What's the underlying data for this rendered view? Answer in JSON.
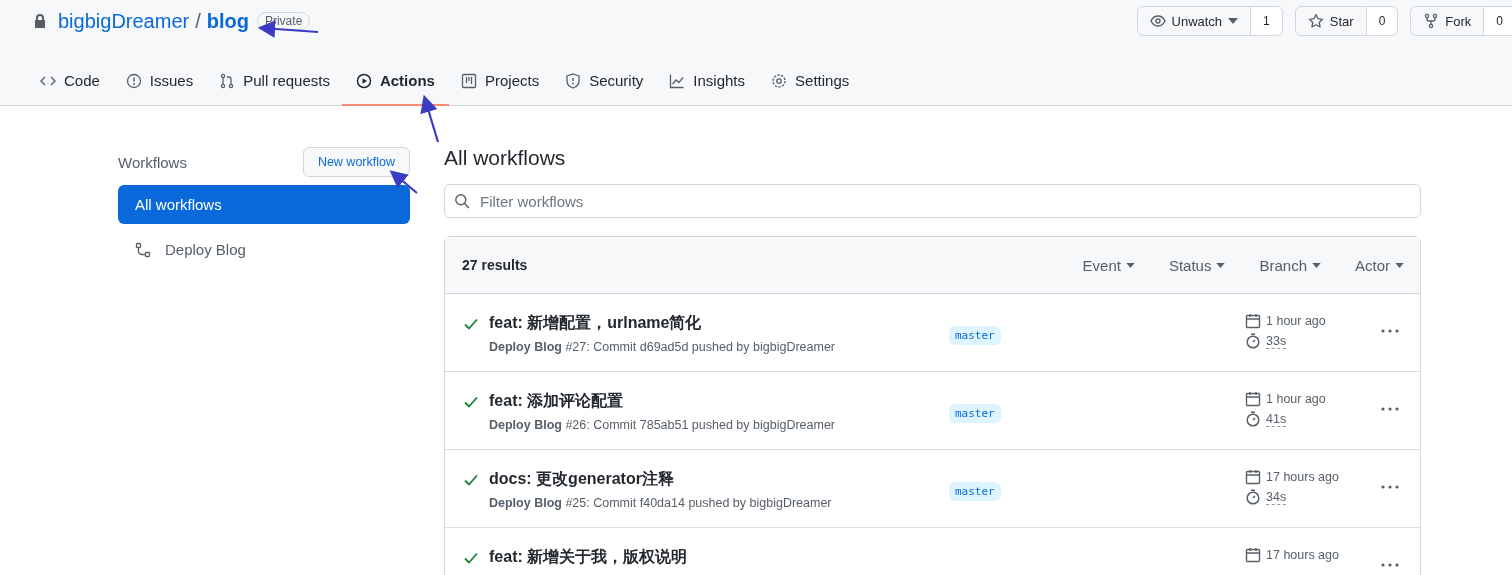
{
  "repo": {
    "owner": "bigbigDreamer",
    "name": "blog",
    "separator": "/",
    "visibility": "Private"
  },
  "repo_actions": [
    {
      "kind": "watch",
      "label": "Unwatch",
      "count": "1"
    },
    {
      "kind": "star",
      "label": "Star",
      "count": "0"
    },
    {
      "kind": "fork",
      "label": "Fork",
      "count": "0"
    }
  ],
  "tabs": [
    {
      "kind": "code",
      "label": "Code",
      "selected": false
    },
    {
      "kind": "issues",
      "label": "Issues",
      "selected": false
    },
    {
      "kind": "pulls",
      "label": "Pull requests",
      "selected": false
    },
    {
      "kind": "actions",
      "label": "Actions",
      "selected": true
    },
    {
      "kind": "projects",
      "label": "Projects",
      "selected": false
    },
    {
      "kind": "security",
      "label": "Security",
      "selected": false
    },
    {
      "kind": "insights",
      "label": "Insights",
      "selected": false
    },
    {
      "kind": "settings",
      "label": "Settings",
      "selected": false
    }
  ],
  "sidebar": {
    "title": "Workflows",
    "new_button": "New workflow",
    "items": [
      {
        "kind": "all",
        "label": "All workflows",
        "selected": true
      },
      {
        "kind": "workflow",
        "label": "Deploy Blog",
        "selected": false
      }
    ]
  },
  "main": {
    "title": "All workflows",
    "filter": {
      "placeholder": "Filter workflows"
    },
    "results": "27 results",
    "filters": [
      "Event",
      "Status",
      "Branch",
      "Actor"
    ],
    "runs": [
      {
        "kind": "success",
        "title": "feat: 新增配置，urlname简化",
        "detail": "**Deploy Blog** #27: Commit d69ad5d pushed by bigbigDreamer",
        "branch": "master",
        "time": "1 hour ago",
        "duration": "33s"
      },
      {
        "kind": "success",
        "title": "feat: 添加评论配置",
        "detail": "**Deploy Blog** #26: Commit 785ab51 pushed by bigbigDreamer",
        "branch": "master",
        "time": "1 hour ago",
        "duration": "41s"
      },
      {
        "kind": "success",
        "title": "docs: 更改generator注释",
        "detail": "**Deploy Blog** #25: Commit f40da14 pushed by bigbigDreamer",
        "branch": "master",
        "time": "17 hours ago",
        "duration": "34s"
      },
      {
        "kind": "success",
        "title": "feat: 新增关于我，版权说明",
        "time": "17 hours ago"
      }
    ]
  }
}
